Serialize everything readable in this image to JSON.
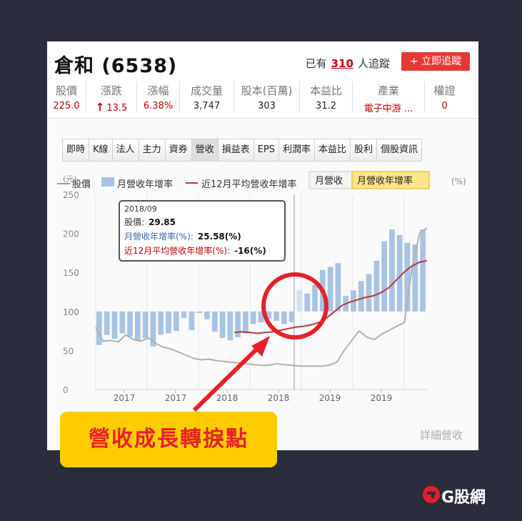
{
  "header": {
    "stock_name": "倉和 (6538)",
    "follow_prefix": "已有",
    "follow_count": "310",
    "follow_suffix": "人追蹤",
    "follow_button": "+ 立即追蹤"
  },
  "stats": [
    {
      "label": "股價",
      "value": "225.0",
      "color": "red"
    },
    {
      "label": "漲跌",
      "value": "13.5",
      "color": "red",
      "arrow": "↑"
    },
    {
      "label": "漲幅",
      "value": "6.38%",
      "color": "red"
    },
    {
      "label": "成交量",
      "value": "3,747",
      "color": "dark"
    },
    {
      "label": "股本(百萬)",
      "value": "303",
      "color": "dark"
    },
    {
      "label": "本益比",
      "value": "31.2",
      "color": "dark"
    },
    {
      "label": "產業",
      "value": "電子中游 ...",
      "color": "red"
    },
    {
      "label": "權證",
      "value": "0",
      "color": "red"
    }
  ],
  "tabs": [
    "即時",
    "K線",
    "法人",
    "主力",
    "資券",
    "營收",
    "損益表",
    "EPS",
    "利潤率",
    "本益比",
    "股利",
    "個股資訊"
  ],
  "active_tab": "營收",
  "legend": {
    "price": "股價",
    "monthly": "月營收年增率",
    "avg12": "近12月平均營收年增率",
    "left_unit": "(元)",
    "right_unit": "(%)"
  },
  "toggle": {
    "option_a": "月營收",
    "option_b": "月營收年增率",
    "active": "月營收年增率"
  },
  "tooltip": {
    "date": "2018/09",
    "price_label": "股價:",
    "price_value": "29.85",
    "monthly_label": "月營收年增率(%):",
    "monthly_value": "25.58(%)",
    "avg_label": "近12月平均營收年增率(%):",
    "avg_value": "-16(%)"
  },
  "detail_link": "詳細營收",
  "callout": "營收成長轉捩點",
  "brand": "G股網",
  "colors": {
    "bar": "#a9c4e2",
    "bar_highlight": "#cfe0f3",
    "avg_line": "#b03a3a",
    "price_line": "#b0b0b0",
    "up": "#c00000",
    "circle": "#e8202a",
    "callout_bg": "#ffcc00"
  },
  "chart_data": {
    "type": "bar",
    "y_left_ticks": [
      250,
      200,
      150,
      100,
      50,
      0
    ],
    "x_tick_labels": [
      "2017",
      "2017",
      "2018",
      "2018",
      "2019",
      "2019"
    ],
    "baseline": 100,
    "ylim": [
      0,
      250
    ],
    "series": [
      {
        "name": "月營收年增率",
        "type": "bar",
        "values": [
          57,
          70,
          65,
          72,
          68,
          62,
          66,
          55,
          70,
          72,
          75,
          92,
          76,
          98,
          90,
          74,
          66,
          63,
          67,
          72,
          84,
          86,
          90,
          88,
          84,
          86,
          127,
          123,
          134,
          153,
          157,
          162,
          120,
          127,
          139,
          148,
          165,
          190,
          205,
          198,
          188,
          186,
          205
        ]
      },
      {
        "name": "近12月平均營收年增率",
        "type": "line",
        "values": [
          null,
          null,
          null,
          null,
          null,
          null,
          null,
          null,
          null,
          null,
          null,
          null,
          null,
          null,
          null,
          null,
          null,
          null,
          73,
          74,
          73,
          72,
          73,
          74,
          76,
          78,
          80,
          81,
          83,
          86,
          92,
          100,
          108,
          112,
          115,
          118,
          120,
          124,
          130,
          140,
          150,
          158,
          163,
          165
        ]
      },
      {
        "name": "股價",
        "type": "line",
        "values": [
          80,
          62,
          63,
          61,
          70,
          64,
          62,
          66,
          59,
          54,
          52,
          48,
          44,
          40,
          38,
          39,
          37,
          36,
          35,
          34,
          33,
          32,
          31,
          31,
          33,
          32,
          31,
          30,
          29.85,
          30,
          30,
          31,
          35,
          50,
          63,
          75,
          67,
          64,
          71,
          76,
          81,
          86,
          155,
          200,
          207
        ]
      }
    ]
  }
}
